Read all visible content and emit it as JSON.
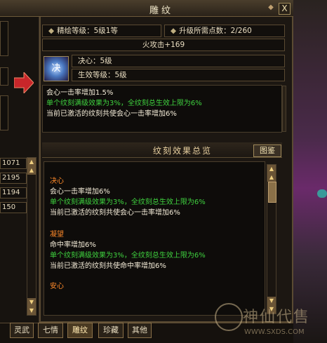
{
  "window": {
    "title": "雕纹",
    "close_label": "X",
    "lock_label": "◆"
  },
  "header": {
    "quality_label": "精绘等级：5级1等",
    "upgrade_label": "升级所需点数：2/260",
    "attack_bonus": "火攻击+169"
  },
  "rune": {
    "icon_char": "决",
    "name_label": "决心：5级",
    "effect_level_label": "生效等级：5级"
  },
  "description": {
    "lines": [
      {
        "text": "会心一击率增加1.5%",
        "color": "white"
      },
      {
        "text": "单个纹刻满级效果为3%，全纹刻总生效上限为6%",
        "color": "green"
      },
      {
        "text": "当前已激活的纹刻共使会心一击率增加6%",
        "color": "white"
      }
    ]
  },
  "summary": {
    "title": "纹刻效果总览",
    "tujian_button": "图鉴",
    "entries": [
      {
        "name": "决心",
        "lines": [
          {
            "text": "会心一击率增加6%",
            "color": "white"
          },
          {
            "text": "单个纹刻满级效果为3%，全纹刻总生效上限为6%",
            "color": "green"
          },
          {
            "text": "当前已激活的纹刻共使会心一击率增加6%",
            "color": "white"
          }
        ]
      },
      {
        "name": "凝望",
        "lines": [
          {
            "text": "命中率增加6%",
            "color": "white"
          },
          {
            "text": "单个纹刻满级效果为3%，全纹刻总生效上限为6%",
            "color": "green"
          },
          {
            "text": "当前已激活的纹刻共使命中率增加6%",
            "color": "white"
          }
        ]
      },
      {
        "name": "安心",
        "lines": []
      }
    ]
  },
  "left_panel": {
    "values": [
      "1071",
      "2195",
      "1194",
      "150"
    ]
  },
  "tabs": [
    {
      "label": "灵武",
      "active": false
    },
    {
      "label": "七情",
      "active": false
    },
    {
      "label": "雕纹",
      "active": true
    },
    {
      "label": "珍藏",
      "active": false
    },
    {
      "label": "其他",
      "active": false
    }
  ],
  "watermark": {
    "text": "神仙代售",
    "url": "WWW.SXDS.COM"
  },
  "colors": {
    "green": "#3fd23f",
    "orange": "#ff8a2a",
    "white": "#f4ecd8",
    "gold_border": "#a08a5a"
  }
}
